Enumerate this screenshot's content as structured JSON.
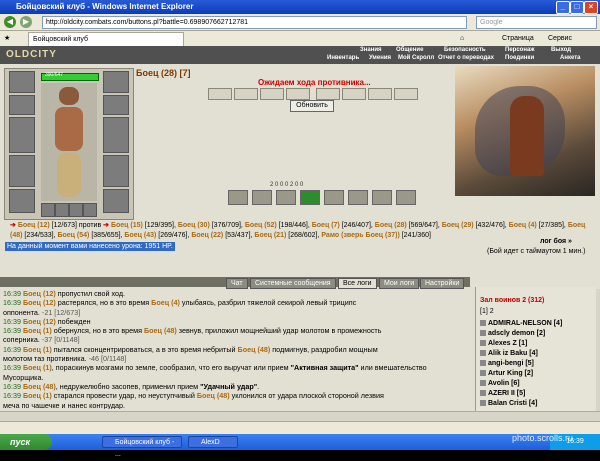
{
  "window": {
    "title": "Бойцовский клуб - Windows Internet Explorer",
    "address": "http://oldcity.combats.com/buttons.pl?battle=0.698907662712781",
    "search_placeholder": "Google",
    "tab_title": "Бойцовский клуб",
    "toolbar_page": "Страница",
    "toolbar_service": "Сервис"
  },
  "game_menu": {
    "row1": [
      "Знания",
      "Общение",
      "Безопасность",
      "Персонаж",
      "Выход"
    ],
    "row2": [
      "Инвентарь",
      "Умения",
      "Мой Скролл",
      "Отчет о переводах",
      "Поединки",
      "Анкета"
    ],
    "logo": "OLDCITY"
  },
  "player": {
    "hp": "390/647"
  },
  "battle": {
    "title": "Боец (28) [7]",
    "waiting": "Ожидаем хода противника...",
    "refresh": "Обновить",
    "counters": "2  0  0  0  2  0  0"
  },
  "opponents": {
    "left_name": "Боец (12)",
    "left_hp": "[12/673]",
    "versus": "против",
    "list": [
      {
        "name": "Боец (15)",
        "hp": "[129/395]"
      },
      {
        "name": "Боец (30)",
        "hp": "[376/709]"
      },
      {
        "name": "Боец (52)",
        "hp": "[198/446]"
      },
      {
        "name": "Боец (7)",
        "hp": "[246/407]"
      },
      {
        "name": "Боец (28)",
        "hp": "[569/647]"
      },
      {
        "name": "Боец (29)",
        "hp": "[432/476]"
      },
      {
        "name": "Боец (4)",
        "hp": "[27/385]"
      },
      {
        "name": "Боец (48)",
        "hp": "[234/533]"
      },
      {
        "name": "Боец (54)",
        "hp": "[385/655]"
      },
      {
        "name": "Боец (43)",
        "hp": "[269/476]"
      },
      {
        "name": "Боец (22)",
        "hp": "[53/437]"
      },
      {
        "name": "Боец (21)",
        "hp": "[268/602]"
      },
      {
        "name": "Рамо (зверь Боец (37))",
        "hp": "[241/360]"
      }
    ]
  },
  "status": {
    "damage": "На данный момент вами нанесено урона: 1951 HP.",
    "more": "лог боя »",
    "timeout": "(Бой идет с таймаутом 1 мин.)"
  },
  "chat_tabs": [
    "Чат",
    "Системные сообщения",
    "Все логи",
    "Мои логи",
    "Настройки"
  ],
  "chat": [
    {
      "t": "16:39",
      "parts": [
        [
          "n",
          "Боец (12)"
        ],
        [
          "",
          " пропустил свой ход."
        ]
      ]
    },
    {
      "t": "16:39",
      "parts": [
        [
          "n",
          "Боец (12)"
        ],
        [
          "",
          " растерялся, но в это время "
        ],
        [
          "n",
          "Боец (4)"
        ],
        [
          "",
          " улыбаясь, разбрил тяжелой секирой левый триципс"
        ]
      ]
    },
    {
      "t": "",
      "parts": [
        [
          "",
          "оппонента. "
        ],
        [
          "g",
          "-21 [12/673]"
        ]
      ]
    },
    {
      "t": "16:39",
      "parts": [
        [
          "n",
          "Боец (12)"
        ],
        [
          "",
          " побежден"
        ]
      ]
    },
    {
      "t": "16:39",
      "parts": [
        [
          "n",
          "Боец (1)"
        ],
        [
          "",
          " обернулся, но в это время "
        ],
        [
          "n",
          "Боец (48)"
        ],
        [
          "",
          " зевнув, приложил мощнейший удар молотом в промежность"
        ]
      ]
    },
    {
      "t": "",
      "parts": [
        [
          "",
          "соперника. "
        ],
        [
          "g",
          "-37 [0/1148]"
        ]
      ]
    },
    {
      "t": "16:39",
      "parts": [
        [
          "n",
          "Боец (1)"
        ],
        [
          "",
          " пытался сконцентрироваться, а в это время небритый "
        ],
        [
          "n",
          "Боец (48)"
        ],
        [
          "",
          " подмигнув, раздробил мощным"
        ]
      ]
    },
    {
      "t": "",
      "parts": [
        [
          "",
          "молотом таз противника. "
        ],
        [
          "g",
          "-46 [0/1148]"
        ]
      ]
    },
    {
      "t": "16:39",
      "parts": [
        [
          "n",
          "Боец (1)"
        ],
        [
          "",
          ", пораскинув мозгами по земле, сообразил, что его выручат или прием "
        ],
        [
          "b",
          "\"Активная защита\""
        ],
        [
          "",
          " или вмешательство"
        ]
      ]
    },
    {
      "t": "",
      "parts": [
        [
          "",
          "Мусорщика."
        ]
      ]
    },
    {
      "t": "16:39",
      "parts": [
        [
          "n",
          "Боец (48)"
        ],
        [
          "",
          ", недружелюбно засопев, применил прием "
        ],
        [
          "b",
          "\"Удачный удар\""
        ],
        [
          "",
          "."
        ]
      ]
    },
    {
      "t": "16:39",
      "parts": [
        [
          "n",
          "Боец (1)"
        ],
        [
          "",
          " старался провести удар, но неуступчивый "
        ],
        [
          "n",
          "Боец (48)"
        ],
        [
          "",
          " уклонился от удара плоской стороной лезвия"
        ]
      ]
    },
    {
      "t": "",
      "parts": [
        [
          "",
          "меча по чашечке и нанес контрудар."
        ]
      ]
    },
    {
      "t": "16:39",
      "parts": [
        [
          "n",
          "Боец (48)"
        ],
        [
          "",
          " замыслив недоброе, использовал прием "
        ],
        [
          "b",
          "\"Скрытая ловкость\""
        ]
      ]
    }
  ],
  "room": {
    "title": "Зал воинов 2 (312)",
    "pages": "[1] 2",
    "users": [
      "ADMIRAL-NELSON [4]",
      "adscly demon [2]",
      "Alexes Z [1]",
      "Alik iz Baku [4]",
      "angi-bengi [5]",
      "Artur King [2]",
      "Avolin [6]",
      "AZERI II [5]",
      "Balan Cristi [4]"
    ]
  },
  "taskbar": {
    "start": "пуск",
    "task1": "Бойцовский клуб - ...",
    "task2": "AlexD",
    "clock": "16:39"
  },
  "watermark": "photo.scrolls.ru"
}
